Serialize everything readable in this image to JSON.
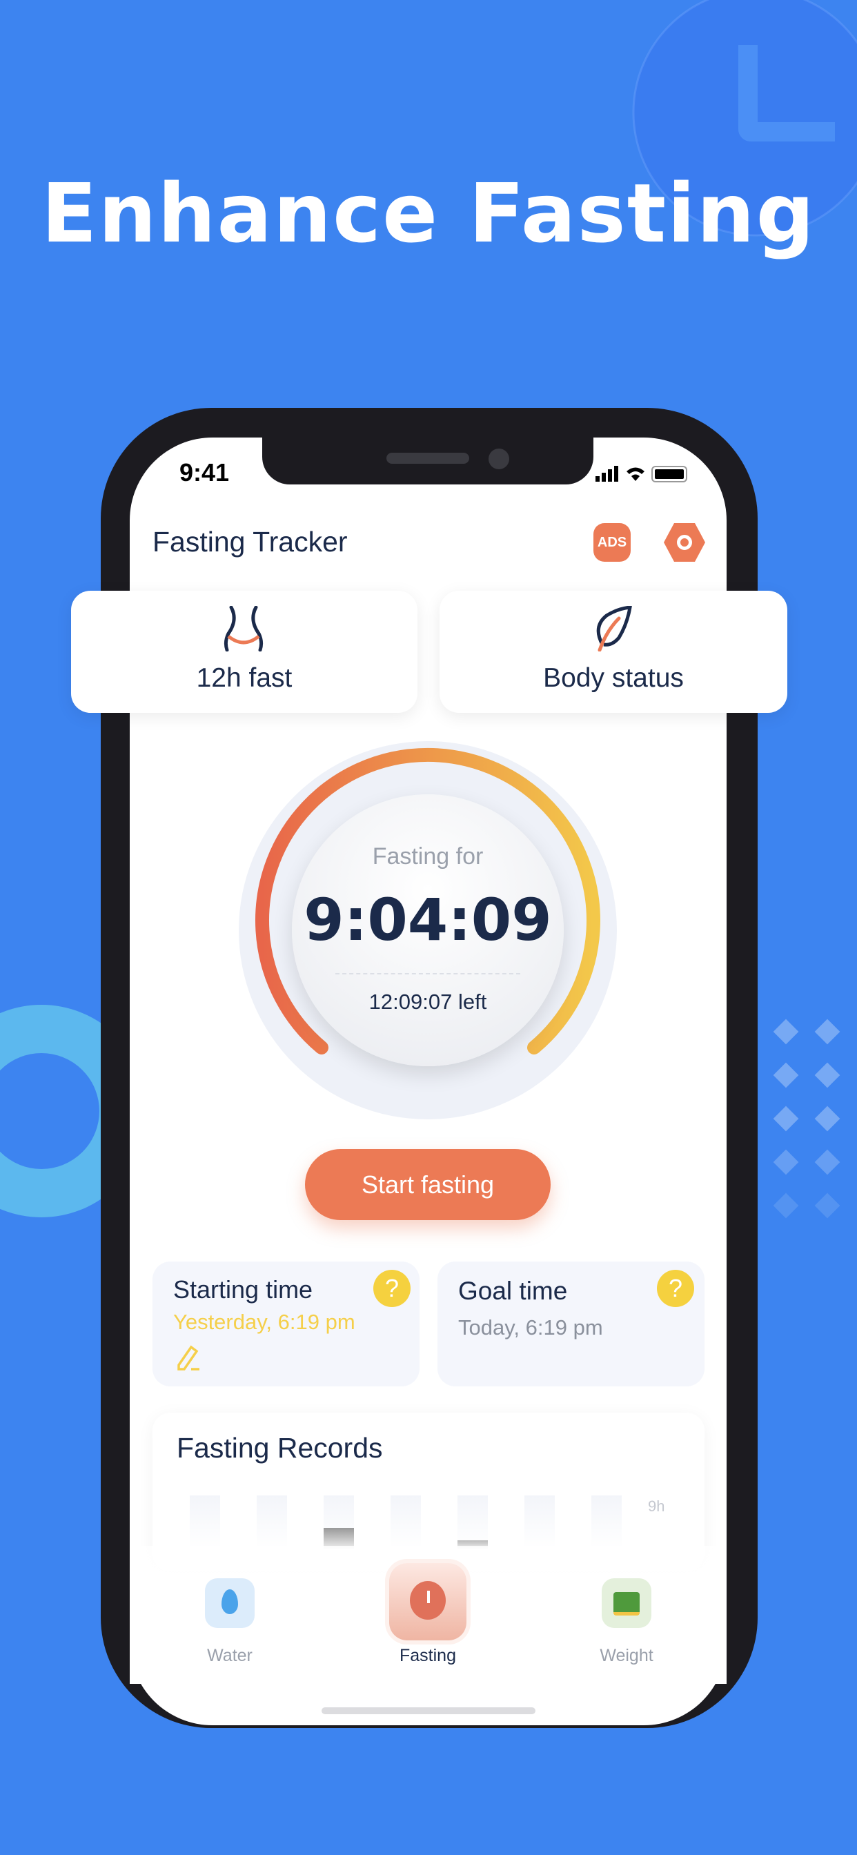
{
  "headline": "Enhance Fasting",
  "status_bar": {
    "time": "9:41"
  },
  "header": {
    "title": "Fasting Tracker",
    "icons": [
      "no-ads-icon",
      "settings-icon"
    ],
    "ads_label": "ADS"
  },
  "quick_cards": [
    {
      "label": "12h fast",
      "icon": "waist-icon"
    },
    {
      "label": "Body status",
      "icon": "leaf-icon"
    }
  ],
  "timer": {
    "caption": "Fasting for",
    "elapsed": "9:04:09",
    "remaining": "12:09:07 left",
    "gradient": [
      "#e8664a",
      "#f3c84a"
    ]
  },
  "start_button": "Start fasting",
  "starting_time": {
    "title": "Starting time",
    "value": "Yesterday, 6:19 pm",
    "help": "?"
  },
  "goal_time": {
    "title": "Goal time",
    "value": "Today, 6:19 pm",
    "help": "?"
  },
  "records": {
    "title": "Fasting Records",
    "axis_label": "9h"
  },
  "nav": [
    {
      "label": "Water",
      "icon": "water-drop-icon"
    },
    {
      "label": "Fasting",
      "icon": "alarm-clock-icon",
      "active": true
    },
    {
      "label": "Weight",
      "icon": "scale-icon"
    }
  ],
  "colors": {
    "background": "#3d84f0",
    "accent": "#ec7a55",
    "help": "#f5d13f",
    "text": "#1b2a4a"
  }
}
